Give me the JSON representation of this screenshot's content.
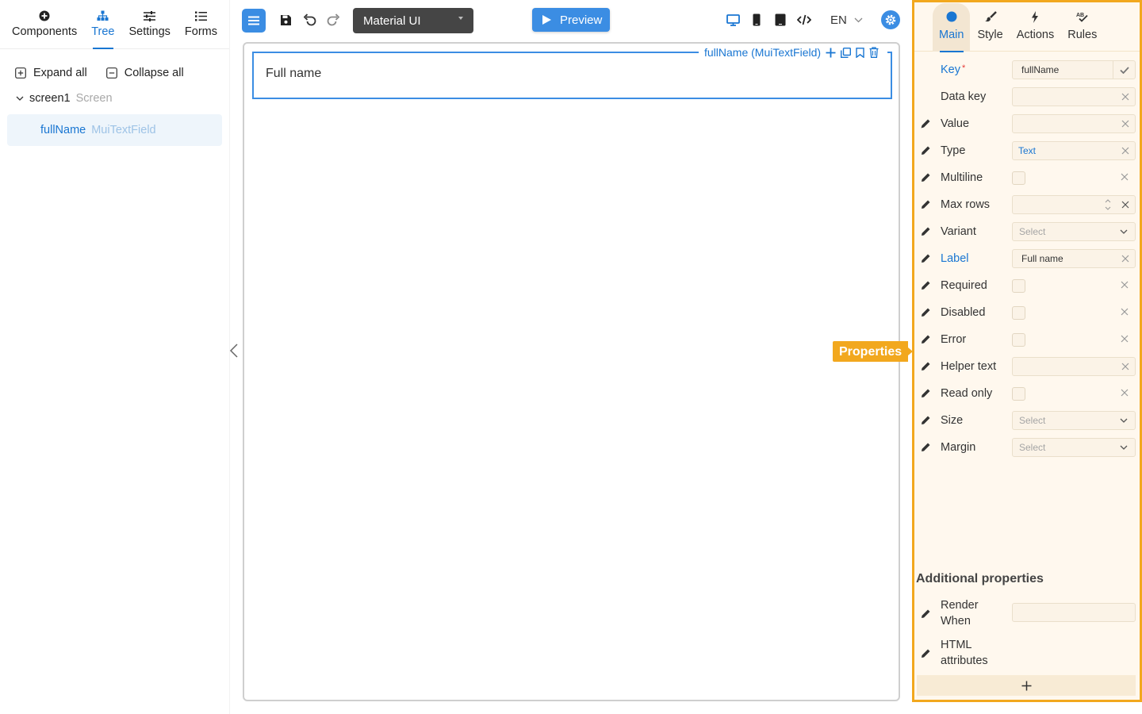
{
  "left_panel": {
    "tabs": [
      {
        "label": "Components",
        "icon": "plus-circle-icon"
      },
      {
        "label": "Tree",
        "icon": "tree-icon",
        "active": true
      },
      {
        "label": "Settings",
        "icon": "sliders-icon"
      },
      {
        "label": "Forms",
        "icon": "list-icon"
      }
    ],
    "expand_all": "Expand all",
    "collapse_all": "Collapse all",
    "tree": {
      "screen_name": "screen1",
      "screen_type": "Screen",
      "item_name": "fullName",
      "item_type": "MuiTextField"
    }
  },
  "toolbar": {
    "library": "Material UI",
    "preview": "Preview",
    "language": "EN",
    "icons": [
      "menu-icon",
      "save-icon",
      "undo-icon",
      "redo-icon",
      "desktop-icon",
      "phone-icon",
      "tablet-icon",
      "code-icon",
      "settings-icon"
    ]
  },
  "canvas": {
    "component_tag": "fullName (MuiTextField)",
    "field_label": "Full name"
  },
  "properties_tab": "Properties",
  "right_panel": {
    "tabs": [
      {
        "label": "Main",
        "icon": "circle-icon",
        "active": true
      },
      {
        "label": "Style",
        "icon": "brush-icon"
      },
      {
        "label": "Actions",
        "icon": "lightning-icon"
      },
      {
        "label": "Rules",
        "icon": "spellcheck-icon"
      }
    ],
    "properties": [
      {
        "label": "Key",
        "required": "*",
        "value": "fullName"
      },
      {
        "label": "Data key",
        "value": ""
      },
      {
        "label": "Value",
        "value": ""
      },
      {
        "label": "Type",
        "value": "Text"
      },
      {
        "label": "Multiline",
        "value": ""
      },
      {
        "label": "Max rows",
        "value": ""
      },
      {
        "label": "Variant",
        "placeholder": "Select"
      },
      {
        "label": "Label",
        "value": "Full name"
      },
      {
        "label": "Required",
        "value": ""
      },
      {
        "label": "Disabled",
        "value": ""
      },
      {
        "label": "Error",
        "value": ""
      },
      {
        "label": "Helper text",
        "value": ""
      },
      {
        "label": "Read only",
        "value": ""
      },
      {
        "label": "Size",
        "placeholder": "Select"
      },
      {
        "label": "Margin",
        "placeholder": "Select"
      }
    ],
    "additional_title": "Additional properties",
    "additional": [
      {
        "label": "Render When"
      },
      {
        "label": "HTML attributes"
      }
    ]
  },
  "colors": {
    "accent": "#1976d2",
    "button_blue": "#3b8de3",
    "highlight_orange": "#f2a81e",
    "panel_bg": "#fff8ee"
  }
}
